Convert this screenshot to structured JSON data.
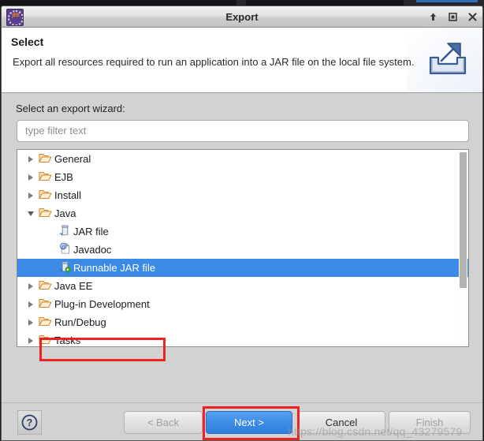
{
  "window": {
    "title": "Export",
    "app_icon": "eclipse-jee-icon",
    "icon_text": "JEE",
    "controls": [
      {
        "name": "minimize-button",
        "icon": "arrow-up-icon"
      },
      {
        "name": "maximize-button",
        "icon": "square-icon"
      },
      {
        "name": "close-button",
        "icon": "close-x-icon"
      }
    ]
  },
  "header": {
    "title": "Select",
    "description": "Export all resources required to run an application into a JAR file on the local file system.",
    "banner_icon": "export-arrow-icon"
  },
  "body": {
    "wizard_label": "Select an export wizard:",
    "filter": {
      "value": "",
      "placeholder": "type filter text"
    },
    "tree": [
      {
        "label": "General",
        "type": "folder",
        "state": "collapsed",
        "level": 0,
        "selected": false
      },
      {
        "label": "EJB",
        "type": "folder",
        "state": "collapsed",
        "level": 0,
        "selected": false
      },
      {
        "label": "Install",
        "type": "folder",
        "state": "collapsed",
        "level": 0,
        "selected": false
      },
      {
        "label": "Java",
        "type": "folder",
        "state": "expanded",
        "level": 0,
        "selected": false
      },
      {
        "label": "JAR file",
        "type": "jar",
        "state": "leaf",
        "level": 1,
        "selected": false
      },
      {
        "label": "Javadoc",
        "type": "javadoc",
        "state": "leaf",
        "level": 1,
        "selected": false
      },
      {
        "label": "Runnable JAR file",
        "type": "runnable-jar",
        "state": "leaf",
        "level": 1,
        "selected": true
      },
      {
        "label": "Java EE",
        "type": "folder",
        "state": "collapsed",
        "level": 0,
        "selected": false
      },
      {
        "label": "Plug-in Development",
        "type": "folder",
        "state": "collapsed",
        "level": 0,
        "selected": false
      },
      {
        "label": "Run/Debug",
        "type": "folder",
        "state": "collapsed",
        "level": 0,
        "selected": false
      },
      {
        "label": "Tasks",
        "type": "folder",
        "state": "collapsed",
        "level": 0,
        "selected": false
      }
    ]
  },
  "footer": {
    "help_label": "?",
    "back_label": "< Back",
    "next_label": "Next >",
    "cancel_label": "Cancel",
    "finish_label": "Finish"
  },
  "annotations": {
    "color": "#ee2222",
    "targets": [
      "Runnable JAR file",
      "Next >"
    ]
  },
  "watermark": "https://blog.csdn.net/qq_43279579",
  "colors": {
    "selection_blue": "#3b8ae5",
    "primary_button": "#3d8de7",
    "annotation_red": "#ee2222",
    "dialog_gray": "#d2d2d2",
    "folder_orange": "#e8a33d"
  }
}
